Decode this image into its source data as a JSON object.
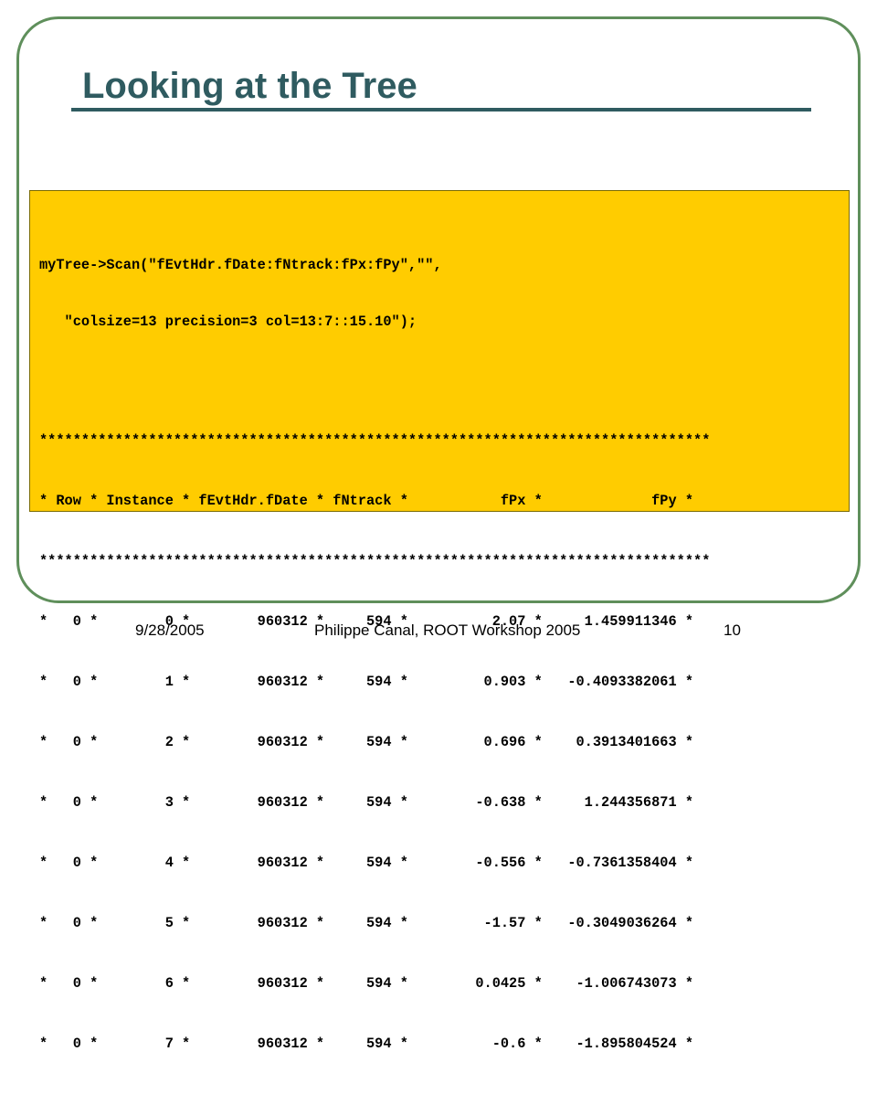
{
  "slide": {
    "title": "Looking at the Tree",
    "colors": {
      "frame": "#5f8f5b",
      "title": "#2f5b60",
      "code_background": "#ffcc00"
    }
  },
  "code": {
    "command_line1": "myTree->Scan(\"fEvtHdr.fDate:fNtrack:fPx:fPy\",\"\",",
    "command_line2": "   \"colsize=13 precision=3 col=13:7::15.10\");",
    "separator": "********************************************************************************",
    "header": "* Row * Instance * fEvtHdr.fDate * fNtrack *           fPx *             fPy *",
    "rows": [
      "*   0 *        0 *        960312 *     594 *          2.07 *     1.459911346 *",
      "*   0 *        1 *        960312 *     594 *         0.903 *   -0.4093382061 *",
      "*   0 *        2 *        960312 *     594 *         0.696 *    0.3913401663 *",
      "*   0 *        3 *        960312 *     594 *        -0.638 *     1.244356871 *",
      "*   0 *        4 *        960312 *     594 *        -0.556 *   -0.7361358404 *",
      "*   0 *        5 *        960312 *     594 *         -1.57 *   -0.3049036264 *",
      "*   0 *        6 *        960312 *     594 *        0.0425 *    -1.006743073 *",
      "*   0 *        7 *        960312 *     594 *          -0.6 *    -1.895804524 *"
    ]
  },
  "footer": {
    "date": "9/28/2005",
    "center": "Philippe Canal, ROOT Workshop 2005",
    "page_number": "10"
  }
}
